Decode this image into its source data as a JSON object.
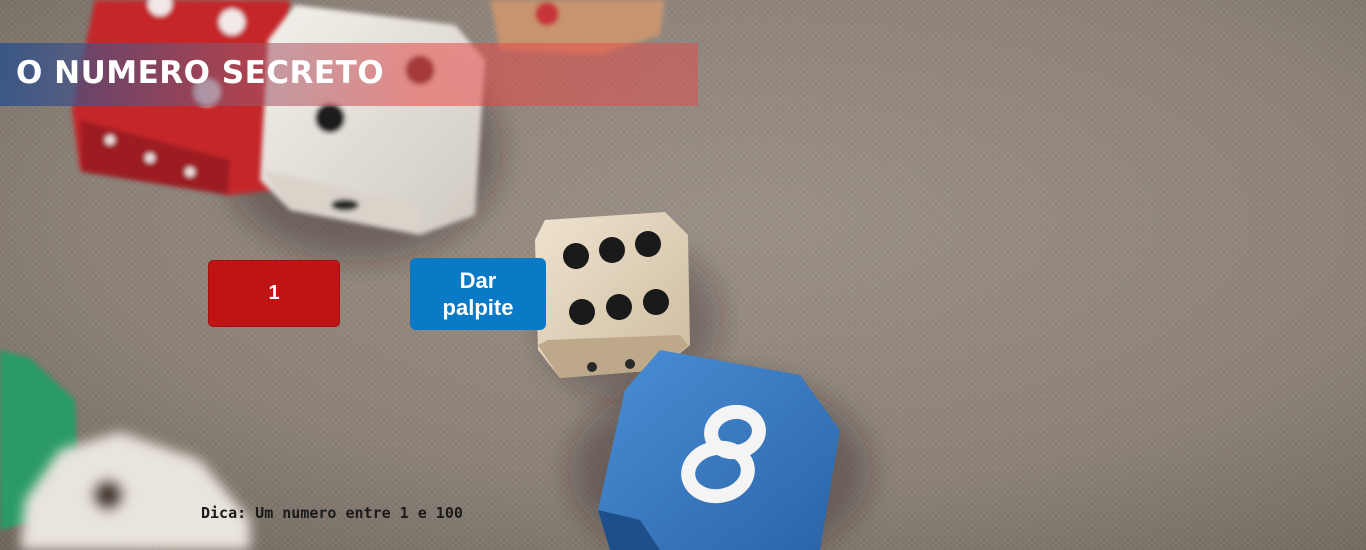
{
  "title": "O NUMERO SECRETO",
  "input": {
    "value": "1"
  },
  "button": {
    "label": "Dar palpite"
  },
  "hint": "Dica: Um numero entre 1 e 100",
  "background_image": "dice-on-fabric",
  "colors": {
    "input_bg": "#c01414",
    "button_bg": "#0a79c6",
    "title_text": "#ffffff",
    "hint_text": "#1a1a1a"
  }
}
